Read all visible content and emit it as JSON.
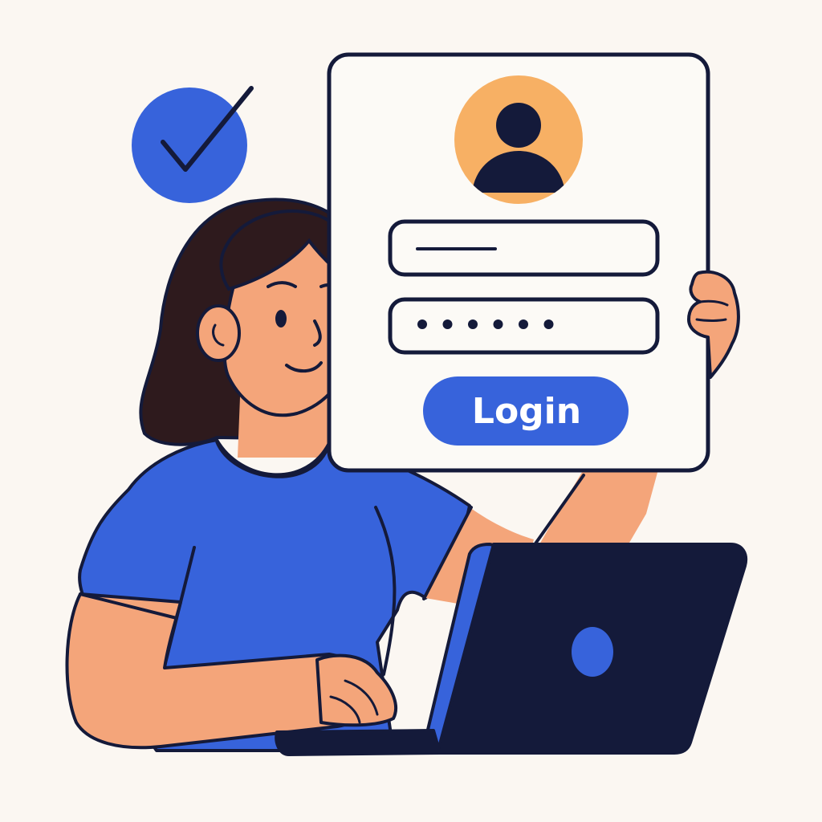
{
  "login_card": {
    "avatar_icon": "user-avatar-icon",
    "username_field": {
      "value_indicator": "text-line"
    },
    "password_field": {
      "masked_value": "••••••",
      "dot_count": 6
    },
    "login_button": {
      "label": "Login"
    }
  },
  "badges": {
    "success_icon": "checkmark-icon"
  },
  "laptop": {
    "logo_icon": "laptop-logo-icon"
  },
  "colors": {
    "background": "#FBF7F2",
    "accent_blue": "#3763DB",
    "navy": "#141A3A",
    "skin": "#F4A57A",
    "avatar_orange": "#F7B064",
    "hair": "#2E1A1D",
    "card_fill": "#FCFAF6"
  }
}
